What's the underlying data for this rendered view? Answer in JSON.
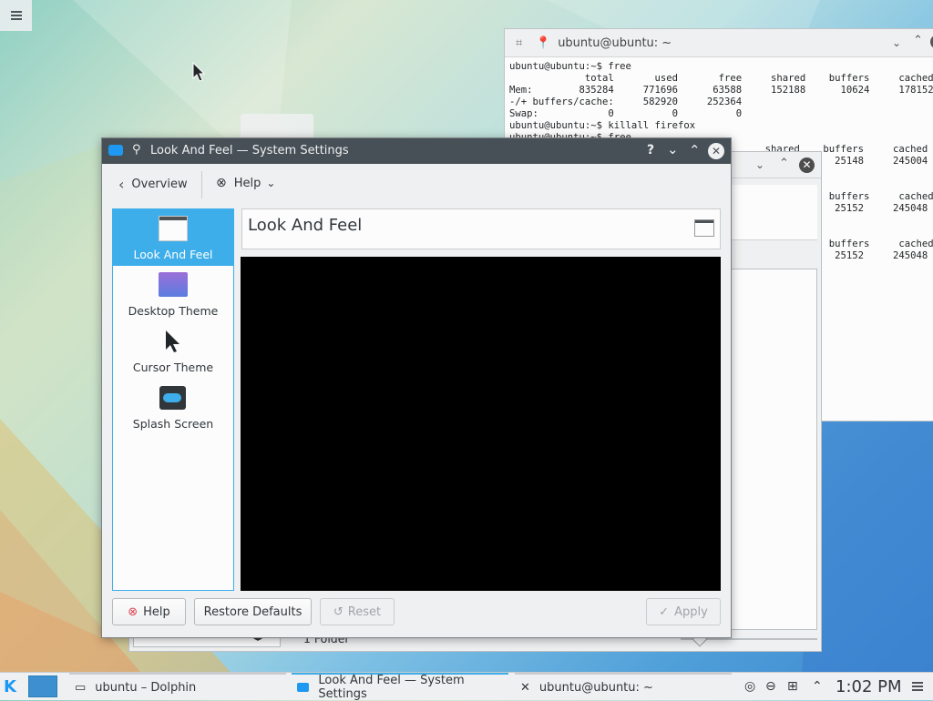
{
  "terminal": {
    "title": "ubuntu@ubuntu: ~",
    "lines": [
      "ubuntu@ubuntu:~$ free",
      "             total       used       free     shared    buffers     cached",
      "Mem:        835284     771696      63588     152188      10624     178152",
      "-/+ buffers/cache:     582920     252364",
      "Swap:            0          0          0",
      "ubuntu@ubuntu:~$ killall firefox",
      "ubuntu@ubuntu:~$ free",
      "                                            shared    buffers     cached",
      "                                                        25148     245004",
      "",
      "",
      "                                                       buffers     cached",
      "                                                        25152     245048",
      "",
      "",
      "                                                       buffers     cached",
      "                                                        25152     245048"
    ]
  },
  "dolphin": {
    "status": "1 Folder"
  },
  "settings": {
    "title": "Look And Feel — System Settings",
    "toolbar": {
      "overview": "Overview",
      "help": "Help"
    },
    "categories": [
      "Look And Feel",
      "Desktop Theme",
      "Cursor Theme",
      "Splash Screen"
    ],
    "page_title": "Look And Feel",
    "buttons": {
      "help": "Help",
      "restore": "Restore Defaults",
      "reset": "Reset",
      "apply": "Apply"
    },
    "titlebar_help": "?"
  },
  "taskbar": {
    "tasks": [
      "ubuntu – Dolphin",
      "Look And Feel — System Settings",
      "ubuntu@ubuntu: ~"
    ],
    "clock": "1:02 PM"
  },
  "colors": {
    "accent": "#3daee9",
    "titlebar": "#475057",
    "panel": "#eff0f1"
  }
}
